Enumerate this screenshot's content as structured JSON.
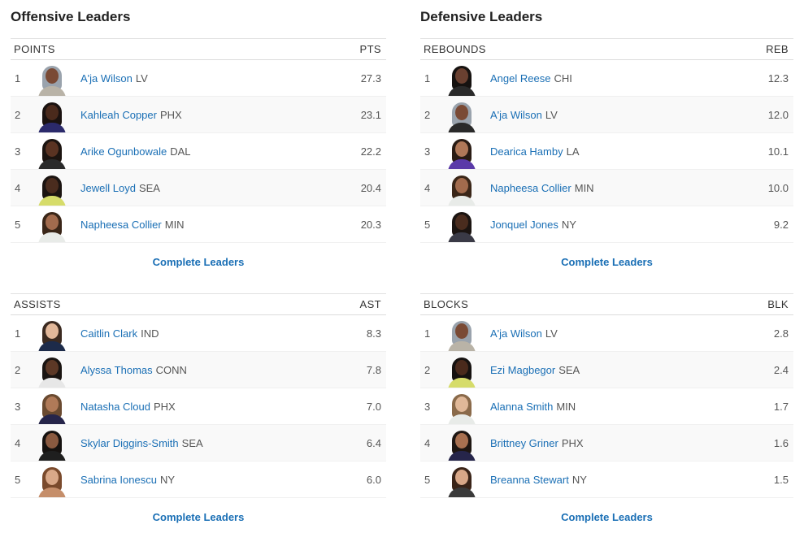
{
  "offensive": {
    "title": "Offensive Leaders",
    "tables": [
      {
        "header": "POINTS",
        "stat_abbr": "PTS",
        "more_label": "Complete Leaders",
        "rows": [
          {
            "rank": "1",
            "name": "A'ja Wilson",
            "team": "LV",
            "value": "27.3",
            "skin": "#7a4a35",
            "hair": "#9aa3ad",
            "jersey": "#b9b3a7"
          },
          {
            "rank": "2",
            "name": "Kahleah Copper",
            "team": "PHX",
            "value": "23.1",
            "skin": "#4a2a1c",
            "hair": "#1a1210",
            "jersey": "#2b2a6b"
          },
          {
            "rank": "3",
            "name": "Arike Ogunbowale",
            "team": "DAL",
            "value": "22.2",
            "skin": "#5a3322",
            "hair": "#1c1410",
            "jersey": "#2a2a2a"
          },
          {
            "rank": "4",
            "name": "Jewell Loyd",
            "team": "SEA",
            "value": "20.4",
            "skin": "#4a2c1e",
            "hair": "#1b1411",
            "jersey": "#d6dc6a"
          },
          {
            "rank": "5",
            "name": "Napheesa Collier",
            "team": "MIN",
            "value": "20.3",
            "skin": "#a26b4d",
            "hair": "#3a2618",
            "jersey": "#e8ebe8"
          }
        ]
      },
      {
        "header": "ASSISTS",
        "stat_abbr": "AST",
        "more_label": "Complete Leaders",
        "rows": [
          {
            "rank": "1",
            "name": "Caitlin Clark",
            "team": "IND",
            "value": "8.3",
            "skin": "#e2b89a",
            "hair": "#3b2a20",
            "jersey": "#1d2b4a"
          },
          {
            "rank": "2",
            "name": "Alyssa Thomas",
            "team": "CONN",
            "value": "7.8",
            "skin": "#5c3826",
            "hair": "#1a1411",
            "jersey": "#e7e7e7"
          },
          {
            "rank": "3",
            "name": "Natasha Cloud",
            "team": "PHX",
            "value": "7.0",
            "skin": "#b07a58",
            "hair": "#6a4a30",
            "jersey": "#26254a"
          },
          {
            "rank": "4",
            "name": "Skylar Diggins-Smith",
            "team": "SEA",
            "value": "6.4",
            "skin": "#8a5a40",
            "hair": "#161210",
            "jersey": "#1f1f1f"
          },
          {
            "rank": "5",
            "name": "Sabrina Ionescu",
            "team": "NY",
            "value": "6.0",
            "skin": "#d9a888",
            "hair": "#7a4a2c",
            "jersey": "#c58e6a"
          }
        ]
      }
    ]
  },
  "defensive": {
    "title": "Defensive Leaders",
    "tables": [
      {
        "header": "REBOUNDS",
        "stat_abbr": "REB",
        "more_label": "Complete Leaders",
        "rows": [
          {
            "rank": "1",
            "name": "Angel Reese",
            "team": "CHI",
            "value": "12.3",
            "skin": "#6a4030",
            "hair": "#161210",
            "jersey": "#2a2a2a"
          },
          {
            "rank": "2",
            "name": "A'ja Wilson",
            "team": "LV",
            "value": "12.0",
            "skin": "#7a4a35",
            "hair": "#9aa3ad",
            "jersey": "#2a2a2a"
          },
          {
            "rank": "3",
            "name": "Dearica Hamby",
            "team": "LA",
            "value": "10.1",
            "skin": "#b07858",
            "hair": "#2a1c14",
            "jersey": "#5a3aa8"
          },
          {
            "rank": "4",
            "name": "Napheesa Collier",
            "team": "MIN",
            "value": "10.0",
            "skin": "#a26b4d",
            "hair": "#3a2618",
            "jersey": "#e8ebe8"
          },
          {
            "rank": "5",
            "name": "Jonquel Jones",
            "team": "NY",
            "value": "9.2",
            "skin": "#4a2c1e",
            "hair": "#1b1411",
            "jersey": "#3a3a46"
          }
        ]
      },
      {
        "header": "BLOCKS",
        "stat_abbr": "BLK",
        "more_label": "Complete Leaders",
        "rows": [
          {
            "rank": "1",
            "name": "A'ja Wilson",
            "team": "LV",
            "value": "2.8",
            "skin": "#7a4a35",
            "hair": "#9aa3ad",
            "jersey": "#b9b3a7"
          },
          {
            "rank": "2",
            "name": "Ezi Magbegor",
            "team": "SEA",
            "value": "2.4",
            "skin": "#4a2a1c",
            "hair": "#161210",
            "jersey": "#d6dc6a"
          },
          {
            "rank": "3",
            "name": "Alanna Smith",
            "team": "MIN",
            "value": "1.7",
            "skin": "#e0b898",
            "hair": "#8a6a4a",
            "jersey": "#e8ebe8"
          },
          {
            "rank": "4",
            "name": "Brittney Griner",
            "team": "PHX",
            "value": "1.6",
            "skin": "#a87050",
            "hair": "#1e1612",
            "jersey": "#26254a"
          },
          {
            "rank": "5",
            "name": "Breanna Stewart",
            "team": "NY",
            "value": "1.5",
            "skin": "#d9a888",
            "hair": "#3a2418",
            "jersey": "#3a3a3a"
          }
        ]
      }
    ]
  }
}
